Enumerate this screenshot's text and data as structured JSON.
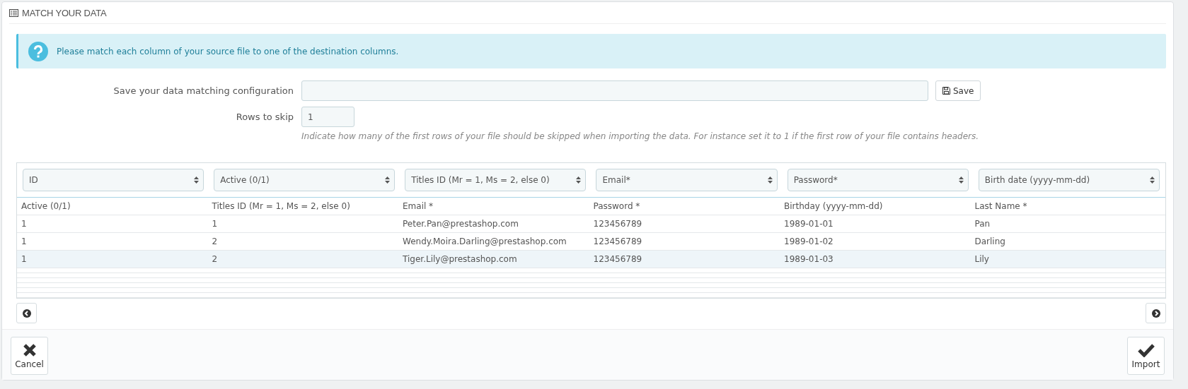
{
  "panel": {
    "title": "MATCH YOUR DATA"
  },
  "alert": {
    "text": "Please match each column of your source file to one of the destination columns."
  },
  "config": {
    "label": "Save your data matching configuration",
    "save_button": "Save"
  },
  "skip": {
    "label": "Rows to skip",
    "value": "1",
    "help": "Indicate how many of the first rows of your file should be skipped when importing the data. For instance set it to 1 if the first row of your file contains headers."
  },
  "table": {
    "selects": [
      "ID",
      "Active (0/1)",
      "Titles ID (Mr = 1, Ms = 2, else 0)",
      "Email*",
      "Password*",
      "Birth date (yyyy-mm-dd)"
    ],
    "header": [
      "Active (0/1)",
      "Titles ID (Mr = 1, Ms = 2, else 0)",
      "Email *",
      "Password *",
      "Birthday (yyyy-mm-dd)",
      "Last Name *"
    ],
    "rows": [
      {
        "selected": false,
        "cells": [
          "1",
          "1",
          "Peter.Pan@prestashop.com",
          "123456789",
          "1989-01-01",
          "Pan"
        ]
      },
      {
        "selected": false,
        "cells": [
          "1",
          "2",
          "Wendy.Moira.Darling@prestashop.com",
          "123456789",
          "1989-01-02",
          "Darling"
        ]
      },
      {
        "selected": true,
        "cells": [
          "1",
          "2",
          "Tiger.Lily@prestashop.com",
          "123456789",
          "1989-01-03",
          "Lily"
        ]
      }
    ]
  },
  "footer": {
    "cancel": "Cancel",
    "import": "Import"
  }
}
